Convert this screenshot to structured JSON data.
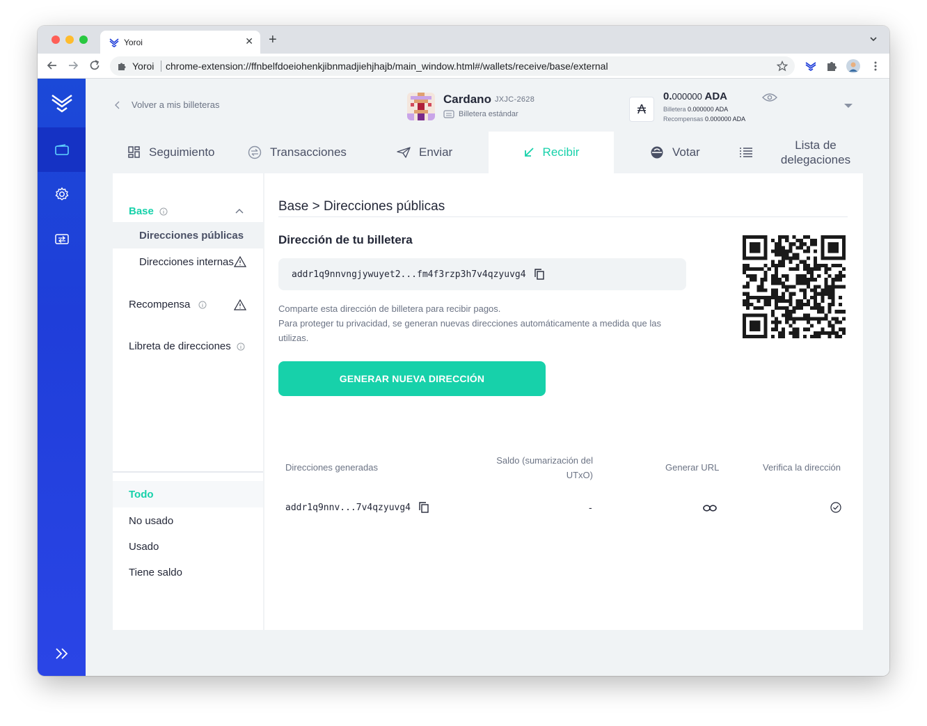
{
  "browser": {
    "tab_title": "Yoroi",
    "omnibox_site": "Yoroi",
    "url": "chrome-extension://ffnbelfdoeiohenkjibnmadjiehjhajb/main_window.html#/wallets/receive/base/external"
  },
  "header": {
    "back_label": "Volver a mis billeteras",
    "wallet_name": "Cardano",
    "wallet_plate": "JXJC-2628",
    "wallet_type": "Billetera estándar",
    "balance_int": "0.",
    "balance_dec": "000000",
    "balance_unit": " ADA",
    "wallet_label": "Billetera",
    "wallet_amount": "0.000000 ADA",
    "rewards_label": "Recompensas",
    "rewards_amount": "0.000000 ADA"
  },
  "nav": {
    "tabs": [
      {
        "label": "Seguimiento",
        "icon": "dashboard-icon"
      },
      {
        "label": "Transacciones",
        "icon": "transactions-icon"
      },
      {
        "label": "Enviar",
        "icon": "send-icon"
      },
      {
        "label": "Recibir",
        "icon": "receive-icon",
        "active": true
      },
      {
        "label": "Votar",
        "icon": "vote-icon"
      },
      {
        "label": "Lista de delegaciones",
        "icon": "list-icon"
      }
    ]
  },
  "left": {
    "base": "Base",
    "public_addresses": "Direcciones públicas",
    "internal_addresses": "Direcciones internas",
    "reward": "Recompensa",
    "address_book": "Libreta de direcciones",
    "filters": [
      "Todo",
      "No usado",
      "Usado",
      "Tiene saldo"
    ]
  },
  "main": {
    "breadcrumb": "Base > Direcciones públicas",
    "wallet_address_title": "Dirección de tu billetera",
    "address": "addr1q9nnvngjywuyet2...fm4f3rzp3h7v4qzyuvg4",
    "desc1": "Comparte esta dirección de billetera para recibir pagos.",
    "desc2": "Para proteger tu privacidad, se generan nuevas direcciones automáticamente a medida que las utilizas.",
    "generate_button": "GENERAR NUEVA DIRECCIÓN",
    "table": {
      "col_address": "Direcciones generadas",
      "col_balance": "Saldo (sumarización del UTxO)",
      "col_url": "Generar URL",
      "col_verify": "Verifica la dirección",
      "rows": [
        {
          "address": "addr1q9nnv...7v4qzyuvg4",
          "balance": "-"
        }
      ]
    }
  },
  "colors": {
    "accent": "#17d1aa",
    "sidebar": "#1f3ed9",
    "sidebar_active": "#1532c4"
  }
}
